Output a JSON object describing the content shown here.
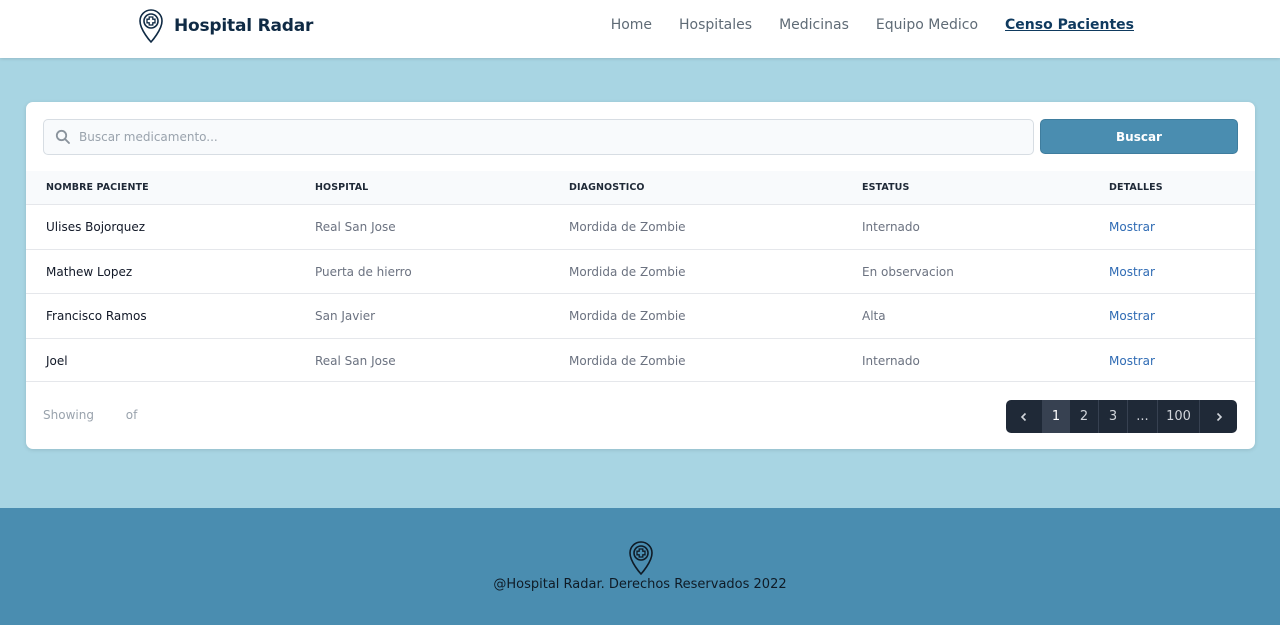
{
  "brand": {
    "name": "Hospital Radar",
    "logo_icon": "hospital-pin-icon"
  },
  "nav": {
    "items": [
      {
        "label": "Home"
      },
      {
        "label": "Hospitales"
      },
      {
        "label": "Medicinas"
      },
      {
        "label": "Equipo Medico"
      },
      {
        "label": "Censo Pacientes",
        "active": true
      }
    ]
  },
  "search": {
    "placeholder": "Buscar medicamento...",
    "value": "",
    "button_label": "Buscar",
    "icon": "search-icon"
  },
  "table": {
    "headers": [
      "NOMBRE PACIENTE",
      "HOSPITAL",
      "DIAGNOSTICO",
      "ESTATUS",
      "DETALLES"
    ],
    "rows": [
      {
        "nombre": "Ulises Bojorquez",
        "hospital": "Real San Jose",
        "diagnostico": "Mordida de Zombie",
        "estatus": "Internado",
        "detalles": "Mostrar"
      },
      {
        "nombre": "Mathew Lopez",
        "hospital": "Puerta de hierro",
        "diagnostico": "Mordida de Zombie",
        "estatus": "En observacion",
        "detalles": "Mostrar"
      },
      {
        "nombre": "Francisco Ramos",
        "hospital": "San Javier",
        "diagnostico": "Mordida de Zombie",
        "estatus": "Alta",
        "detalles": "Mostrar"
      },
      {
        "nombre": "Joel",
        "hospital": "Real San Jose",
        "diagnostico": "Mordida de Zombie",
        "estatus": "Internado",
        "detalles": "Mostrar"
      }
    ]
  },
  "pagination": {
    "showing_label": "Showing",
    "of_label": "of",
    "pages": [
      "1",
      "2",
      "3",
      "...",
      "100"
    ],
    "current": "1",
    "prev_icon": "chevron-left-icon",
    "next_icon": "chevron-right-icon"
  },
  "footer": {
    "text": "@Hospital Radar. Derechos Reservados 2022",
    "logo_icon": "hospital-pin-icon"
  },
  "colors": {
    "page_bg": "#a8d5e3",
    "accent": "#4a8db0",
    "footer_bg": "#4a8db0",
    "brand_text": "#0f2a44",
    "link": "#2f6bb4",
    "pager_bg": "#1f2937"
  }
}
